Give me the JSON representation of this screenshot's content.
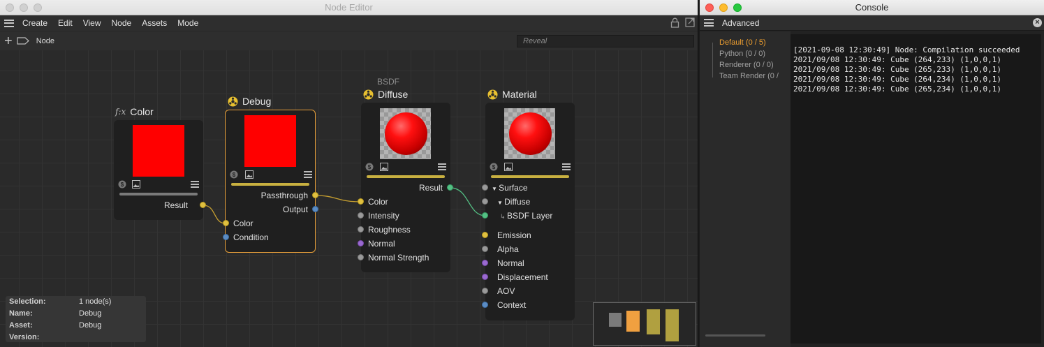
{
  "node_editor": {
    "window_title": "Node Editor",
    "menu": [
      "Create",
      "Edit",
      "View",
      "Node",
      "Assets",
      "Mode"
    ],
    "toolbar": {
      "breadcrumb": "Node",
      "search_placeholder": "Reveal"
    },
    "nodes": {
      "color": {
        "title": "Color",
        "outputs": [
          "Result"
        ]
      },
      "debug": {
        "title": "Debug",
        "outputs": [
          "Passthrough",
          "Output"
        ],
        "inputs": [
          "Color",
          "Condition"
        ]
      },
      "diffuse": {
        "category": "BSDF",
        "title": "Diffuse",
        "outputs": [
          "Result"
        ],
        "inputs": [
          "Color",
          "Intensity",
          "Roughness",
          "Normal",
          "Normal Strength"
        ]
      },
      "material": {
        "title": "Material",
        "inputs": [
          "Surface",
          "Diffuse",
          "BSDF Layer",
          "Emission",
          "Alpha",
          "Normal",
          "Displacement",
          "AOV",
          "Context"
        ]
      }
    },
    "info": [
      {
        "key": "Selection:",
        "value": "1 node(s)"
      },
      {
        "key": "Name:",
        "value": "Debug"
      },
      {
        "key": "Asset:",
        "value": "Debug"
      },
      {
        "key": "Version:",
        "value": ""
      }
    ],
    "colors": {
      "selected_border": "#e8a03a",
      "preview_red": "#ff0000",
      "bar_yellow": "#c8b040"
    }
  },
  "console": {
    "window_title": "Console",
    "menu_label": "Advanced",
    "channels": [
      "Default (0 / 5)",
      "Python (0 / 0)",
      "Renderer (0 / 0)",
      "Team Render  (0 /"
    ],
    "active_channel": "Default (0 / 5)",
    "lines": [
      "[2021-09-08 12:30:49] Node: Compilation succeeded",
      "2021/09/08 12:30:49: Cube (264,233) (1,0,0,1)",
      "2021/09/08 12:30:49: Cube (265,233) (1,0,0,1)",
      "2021/09/08 12:30:49: Cube (264,234) (1,0,0,1)",
      "2021/09/08 12:30:49: Cube (265,234) (1,0,0,1)"
    ]
  }
}
